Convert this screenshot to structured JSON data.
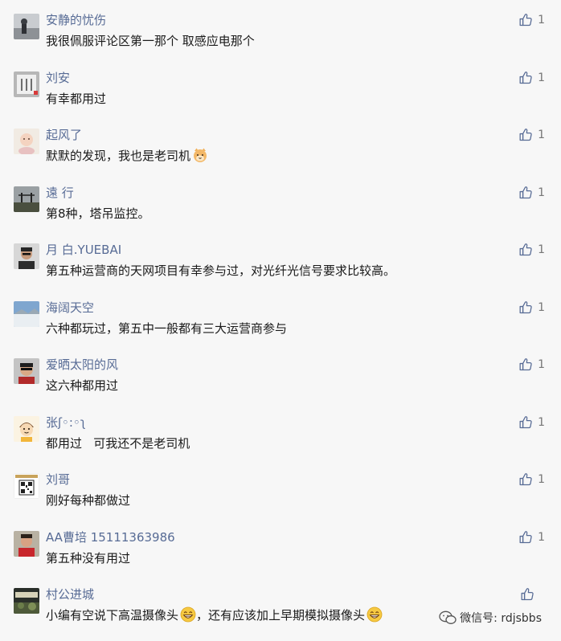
{
  "colors": {
    "background": "#f7f7f7",
    "nickname": "#576b95",
    "content": "#1a1a1a",
    "like": "#777777"
  },
  "comments": [
    {
      "nickname": "安静的忧伤",
      "content": "我很佩服评论区第一那个 取感应电那个",
      "likes": "1"
    },
    {
      "nickname": "刘安",
      "content": "有幸都用过",
      "likes": "1"
    },
    {
      "nickname": "起风了",
      "content": "默默的发现，我也是老司机",
      "likes": "1",
      "emoji": "cat-emoji"
    },
    {
      "nickname": "遠 行",
      "content": "第8种，塔吊监控。",
      "likes": "1"
    },
    {
      "nickname": "月 白.YUEBAI",
      "content": "第五种运营商的天网项目有幸参与过，对光纤光信号要求比较高。",
      "likes": "1"
    },
    {
      "nickname": "海阔天空",
      "content": "六种都玩过，第五中一般都有三大运营商参与",
      "likes": "1"
    },
    {
      "nickname": "爱晒太阳的风",
      "content": "这六种都用过",
      "likes": "1"
    },
    {
      "nickname": "张ʃ◦:◦ʅ",
      "content": "都用过   可我还不是老司机",
      "likes": "1"
    },
    {
      "nickname": "刘哥",
      "content": "刚好每种都做过",
      "likes": "1"
    },
    {
      "nickname": "AA曹培 15111363986",
      "content": "第五种没有用过",
      "likes": "1"
    },
    {
      "nickname": "村公进城",
      "content_part1": "小编有空说下高温摄像头",
      "content_part2": "，还有应该加上早期模拟摄像头",
      "likes": "",
      "emoji": "grin-emoji"
    }
  ],
  "watermark": {
    "text": "微信号: rdjsbbs",
    "icon": "wechat-icon"
  }
}
